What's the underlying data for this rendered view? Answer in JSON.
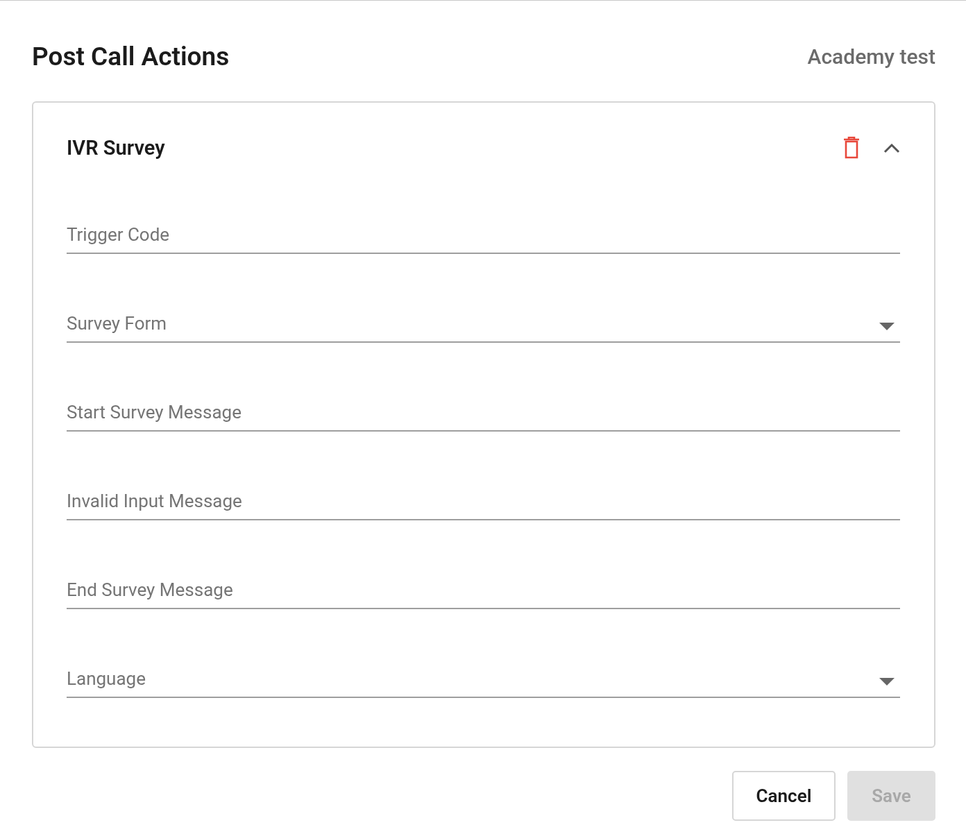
{
  "title": "Post Call Actions",
  "account": "Academy test",
  "section": {
    "title": "IVR Survey",
    "expanded": true,
    "fields": [
      {
        "kind": "text",
        "placeholder": "Trigger Code"
      },
      {
        "kind": "select",
        "placeholder": "Survey Form"
      },
      {
        "kind": "text",
        "placeholder": "Start Survey Message"
      },
      {
        "kind": "text",
        "placeholder": "Invalid Input Message"
      },
      {
        "kind": "text",
        "placeholder": "End Survey Message"
      },
      {
        "kind": "select",
        "placeholder": "Language"
      }
    ]
  },
  "buttons": [
    {
      "label": "Cancel",
      "disabled": false
    },
    {
      "label": "Save",
      "disabled": true
    }
  ]
}
